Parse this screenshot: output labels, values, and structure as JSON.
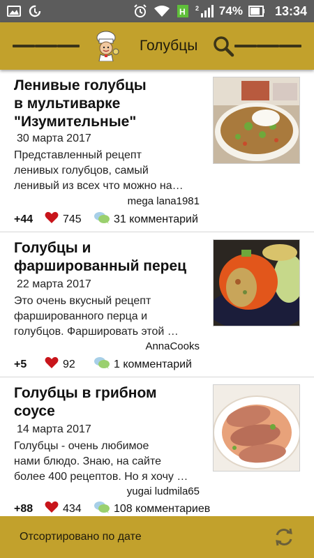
{
  "status_bar": {
    "battery": "74%",
    "time": "13:34",
    "sim": "2",
    "icons": [
      "gallery-icon",
      "data-saver-icon",
      "alarm-icon",
      "wifi-icon",
      "signal-icon",
      "battery-icon"
    ]
  },
  "app_bar": {
    "title": "Голубцы",
    "icons": [
      "menu-icon",
      "chef-logo-icon",
      "search-icon",
      "list-menu-icon"
    ],
    "accent_color": "#c2a12c"
  },
  "recipes": [
    {
      "title_lines": [
        "Ленивые голубцы",
        "в мультиварке",
        "\"Изумительные\""
      ],
      "date": "30 марта 2017",
      "desc_lines": [
        "Представленный рецепт",
        "ленивых голубцов, самый",
        "ленивый из всех что можно на…"
      ],
      "author": "mega lana1981",
      "score": "+44",
      "likes": "745",
      "comments": "31 комментарий"
    },
    {
      "title_lines": [
        "Голубцы и",
        "фаршированный перец"
      ],
      "date": "22 марта 2017",
      "desc_lines": [
        "Это очень вкусный рецепт",
        "фаршированного перца и",
        "голубцов. Фаршировать этой …"
      ],
      "author": "AnnaCooks",
      "score": "+5",
      "likes": "92",
      "comments": "1 комментарий"
    },
    {
      "title_lines": [
        "Голубцы в грибном",
        "соусе"
      ],
      "date": "14 марта 2017",
      "desc_lines": [
        "Голубцы - очень любимое",
        "нами блюдо. Знаю, на сайте",
        "более 400 рецептов. Но я хочу …"
      ],
      "author": "yugai ludmila65",
      "score": "+88",
      "likes": "434",
      "comments": "108 комментариев"
    }
  ],
  "bottom_bar": {
    "sort_label": "Отсортировано по дате",
    "icon": "refresh-icon"
  }
}
